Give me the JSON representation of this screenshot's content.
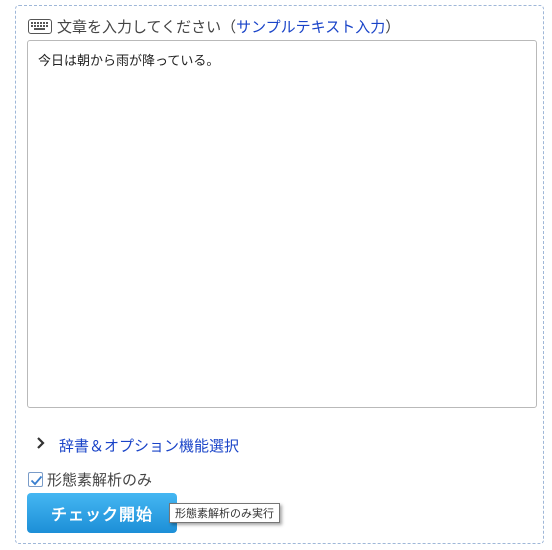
{
  "prompt": {
    "label": "文章を入力してください",
    "paren_open": "（",
    "sample_link": "サンプルテキスト入力",
    "paren_close": "）"
  },
  "textarea": {
    "value": "今日は朝から雨が降っている。"
  },
  "options": {
    "link": "辞書＆オプション機能選択"
  },
  "morph_only": {
    "label": "形態素解析のみ",
    "checked": true
  },
  "start_button": {
    "label": "チェック開始"
  },
  "tooltip": {
    "text": "形態素解析のみ実行"
  },
  "colors": {
    "link": "#1a44c8",
    "button": "#2fa3e6",
    "border": "#9fb7d8"
  }
}
